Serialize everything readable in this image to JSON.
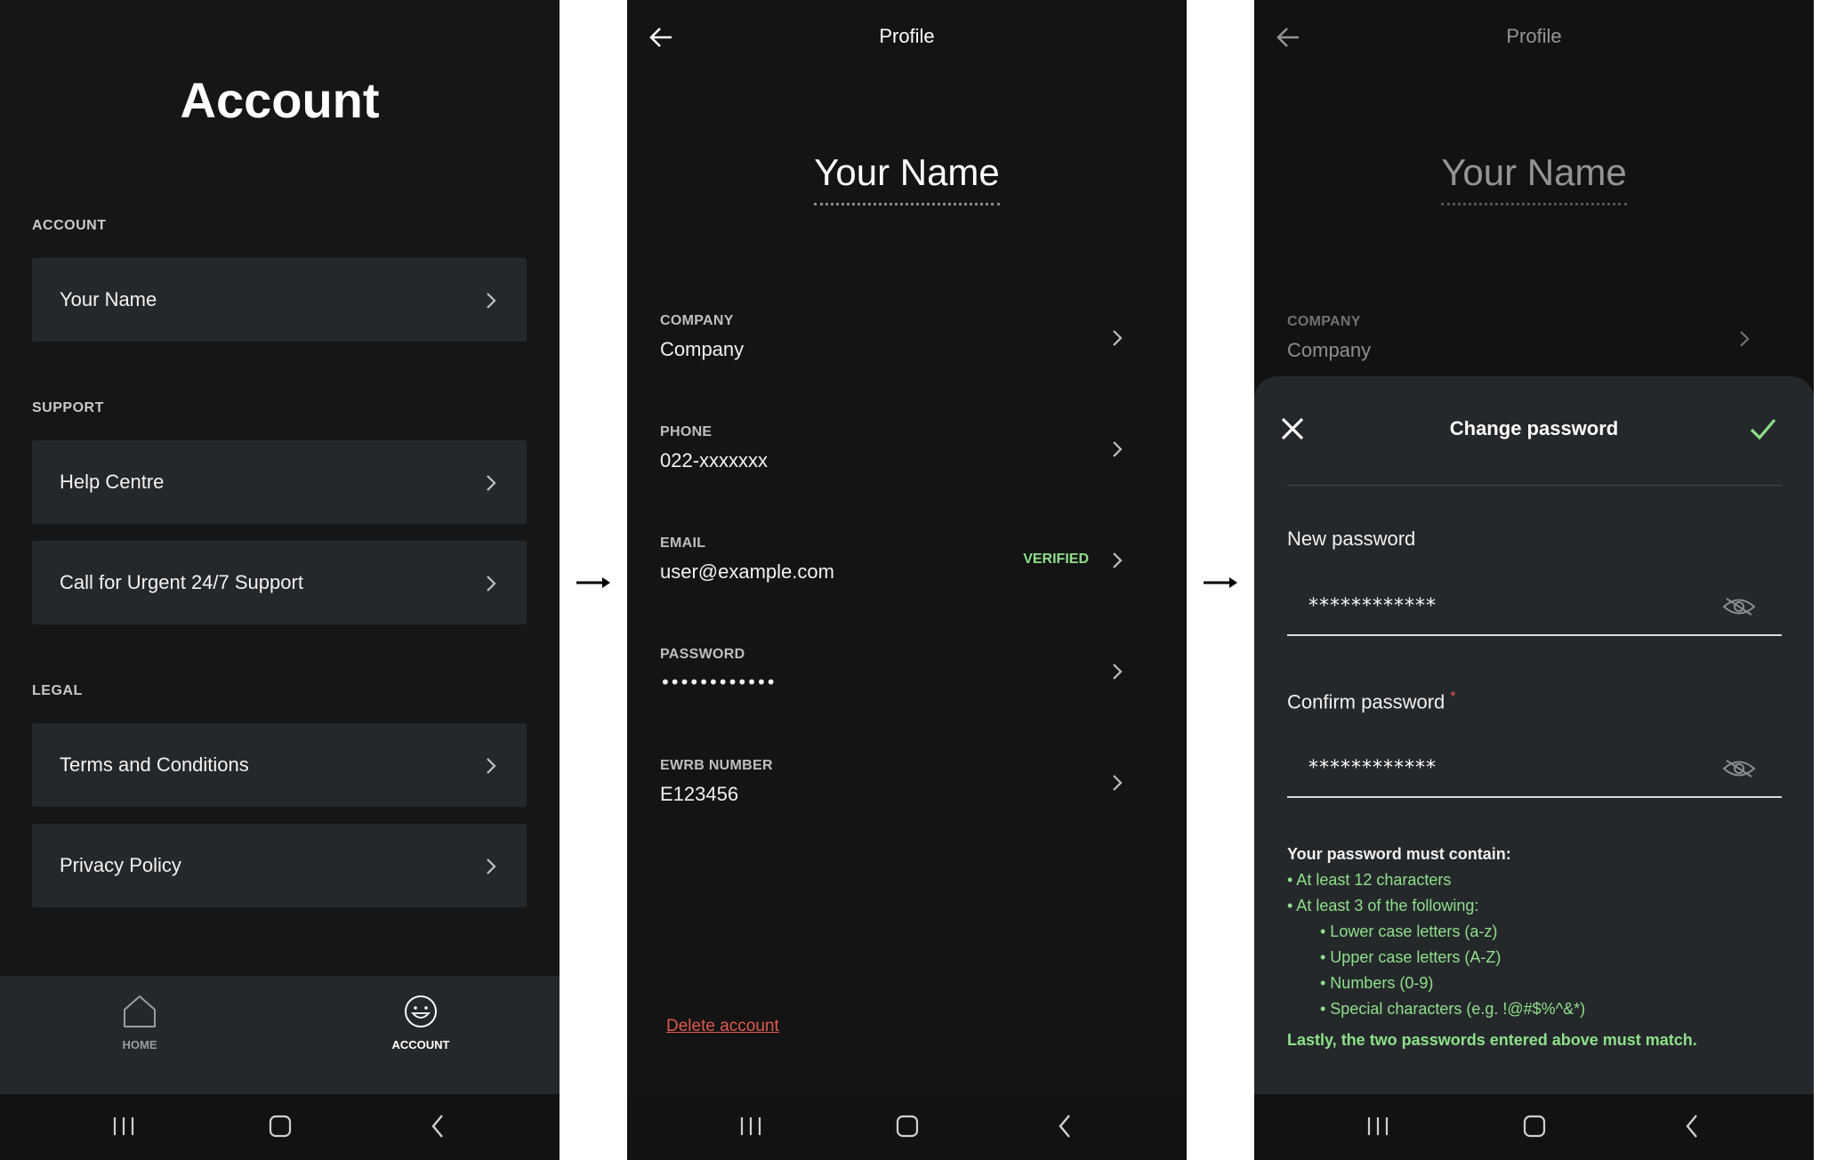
{
  "screen1": {
    "title": "Account",
    "sections": {
      "account": {
        "label": "ACCOUNT",
        "items": [
          "Your Name"
        ]
      },
      "support": {
        "label": "SUPPORT",
        "items": [
          "Help Centre",
          "Call for Urgent 24/7 Support"
        ]
      },
      "legal": {
        "label": "LEGAL",
        "items": [
          "Terms and Conditions",
          "Privacy Policy"
        ]
      }
    },
    "tabs": {
      "home": "HOME",
      "account": "ACCOUNT",
      "active": "account"
    }
  },
  "screen2": {
    "title": "Profile",
    "name": "Your Name",
    "fields": {
      "company": {
        "label": "COMPANY",
        "value": "Company"
      },
      "phone": {
        "label": "PHONE",
        "value": "022-xxxxxxx"
      },
      "email": {
        "label": "EMAIL",
        "value": "user@example.com",
        "badge": "VERIFIED"
      },
      "password": {
        "label": "PASSWORD",
        "value": "••••••••••••"
      },
      "ewrb": {
        "label": "EWRB NUMBER",
        "value": "E123456"
      }
    },
    "delete_label": "Delete account"
  },
  "screen3": {
    "title": "Profile",
    "name": "Your Name",
    "company": {
      "label": "COMPANY",
      "value": "Company"
    },
    "sheet": {
      "title": "Change password",
      "new_label": "New password",
      "new_value": "************",
      "confirm_label": "Confirm password",
      "required_mark": "*",
      "confirm_value": "************",
      "rules": {
        "heading": "Your password must contain:",
        "r1": "• At least 12 characters",
        "r2": "• At least 3 of the following:",
        "r3": "• Lower case letters (a-z)",
        "r4": "• Upper case letters (A-Z)",
        "r5": "• Numbers (0-9)",
        "r6": "• Special characters (e.g. !@#$%^&*)",
        "footer": "Lastly, the two passwords entered above must match."
      }
    }
  },
  "colors": {
    "success": "#8ee08a",
    "danger": "#e05a4f",
    "card": "#25282b"
  },
  "icons": [
    "back-arrow-icon",
    "chevron-right-icon",
    "home-icon",
    "smiley-icon",
    "close-icon",
    "check-icon",
    "eye-off-icon",
    "recents-icon",
    "home-button-icon",
    "back-nav-icon",
    "flow-arrow-icon"
  ]
}
